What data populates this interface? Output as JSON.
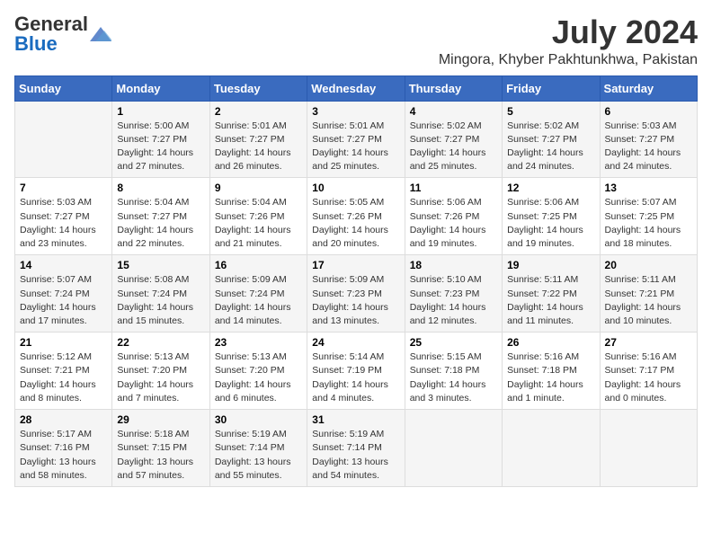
{
  "header": {
    "logo": {
      "general": "General",
      "blue": "Blue"
    },
    "title": "July 2024",
    "location": "Mingora, Khyber Pakhtunkhwa, Pakistan"
  },
  "weekdays": [
    "Sunday",
    "Monday",
    "Tuesday",
    "Wednesday",
    "Thursday",
    "Friday",
    "Saturday"
  ],
  "weeks": [
    [
      {
        "day": "",
        "info": ""
      },
      {
        "day": "1",
        "info": "Sunrise: 5:00 AM\nSunset: 7:27 PM\nDaylight: 14 hours\nand 27 minutes."
      },
      {
        "day": "2",
        "info": "Sunrise: 5:01 AM\nSunset: 7:27 PM\nDaylight: 14 hours\nand 26 minutes."
      },
      {
        "day": "3",
        "info": "Sunrise: 5:01 AM\nSunset: 7:27 PM\nDaylight: 14 hours\nand 25 minutes."
      },
      {
        "day": "4",
        "info": "Sunrise: 5:02 AM\nSunset: 7:27 PM\nDaylight: 14 hours\nand 25 minutes."
      },
      {
        "day": "5",
        "info": "Sunrise: 5:02 AM\nSunset: 7:27 PM\nDaylight: 14 hours\nand 24 minutes."
      },
      {
        "day": "6",
        "info": "Sunrise: 5:03 AM\nSunset: 7:27 PM\nDaylight: 14 hours\nand 24 minutes."
      }
    ],
    [
      {
        "day": "7",
        "info": "Sunrise: 5:03 AM\nSunset: 7:27 PM\nDaylight: 14 hours\nand 23 minutes."
      },
      {
        "day": "8",
        "info": "Sunrise: 5:04 AM\nSunset: 7:27 PM\nDaylight: 14 hours\nand 22 minutes."
      },
      {
        "day": "9",
        "info": "Sunrise: 5:04 AM\nSunset: 7:26 PM\nDaylight: 14 hours\nand 21 minutes."
      },
      {
        "day": "10",
        "info": "Sunrise: 5:05 AM\nSunset: 7:26 PM\nDaylight: 14 hours\nand 20 minutes."
      },
      {
        "day": "11",
        "info": "Sunrise: 5:06 AM\nSunset: 7:26 PM\nDaylight: 14 hours\nand 19 minutes."
      },
      {
        "day": "12",
        "info": "Sunrise: 5:06 AM\nSunset: 7:25 PM\nDaylight: 14 hours\nand 19 minutes."
      },
      {
        "day": "13",
        "info": "Sunrise: 5:07 AM\nSunset: 7:25 PM\nDaylight: 14 hours\nand 18 minutes."
      }
    ],
    [
      {
        "day": "14",
        "info": "Sunrise: 5:07 AM\nSunset: 7:24 PM\nDaylight: 14 hours\nand 17 minutes."
      },
      {
        "day": "15",
        "info": "Sunrise: 5:08 AM\nSunset: 7:24 PM\nDaylight: 14 hours\nand 15 minutes."
      },
      {
        "day": "16",
        "info": "Sunrise: 5:09 AM\nSunset: 7:24 PM\nDaylight: 14 hours\nand 14 minutes."
      },
      {
        "day": "17",
        "info": "Sunrise: 5:09 AM\nSunset: 7:23 PM\nDaylight: 14 hours\nand 13 minutes."
      },
      {
        "day": "18",
        "info": "Sunrise: 5:10 AM\nSunset: 7:23 PM\nDaylight: 14 hours\nand 12 minutes."
      },
      {
        "day": "19",
        "info": "Sunrise: 5:11 AM\nSunset: 7:22 PM\nDaylight: 14 hours\nand 11 minutes."
      },
      {
        "day": "20",
        "info": "Sunrise: 5:11 AM\nSunset: 7:21 PM\nDaylight: 14 hours\nand 10 minutes."
      }
    ],
    [
      {
        "day": "21",
        "info": "Sunrise: 5:12 AM\nSunset: 7:21 PM\nDaylight: 14 hours\nand 8 minutes."
      },
      {
        "day": "22",
        "info": "Sunrise: 5:13 AM\nSunset: 7:20 PM\nDaylight: 14 hours\nand 7 minutes."
      },
      {
        "day": "23",
        "info": "Sunrise: 5:13 AM\nSunset: 7:20 PM\nDaylight: 14 hours\nand 6 minutes."
      },
      {
        "day": "24",
        "info": "Sunrise: 5:14 AM\nSunset: 7:19 PM\nDaylight: 14 hours\nand 4 minutes."
      },
      {
        "day": "25",
        "info": "Sunrise: 5:15 AM\nSunset: 7:18 PM\nDaylight: 14 hours\nand 3 minutes."
      },
      {
        "day": "26",
        "info": "Sunrise: 5:16 AM\nSunset: 7:18 PM\nDaylight: 14 hours\nand 1 minute."
      },
      {
        "day": "27",
        "info": "Sunrise: 5:16 AM\nSunset: 7:17 PM\nDaylight: 14 hours\nand 0 minutes."
      }
    ],
    [
      {
        "day": "28",
        "info": "Sunrise: 5:17 AM\nSunset: 7:16 PM\nDaylight: 13 hours\nand 58 minutes."
      },
      {
        "day": "29",
        "info": "Sunrise: 5:18 AM\nSunset: 7:15 PM\nDaylight: 13 hours\nand 57 minutes."
      },
      {
        "day": "30",
        "info": "Sunrise: 5:19 AM\nSunset: 7:14 PM\nDaylight: 13 hours\nand 55 minutes."
      },
      {
        "day": "31",
        "info": "Sunrise: 5:19 AM\nSunset: 7:14 PM\nDaylight: 13 hours\nand 54 minutes."
      },
      {
        "day": "",
        "info": ""
      },
      {
        "day": "",
        "info": ""
      },
      {
        "day": "",
        "info": ""
      }
    ]
  ]
}
